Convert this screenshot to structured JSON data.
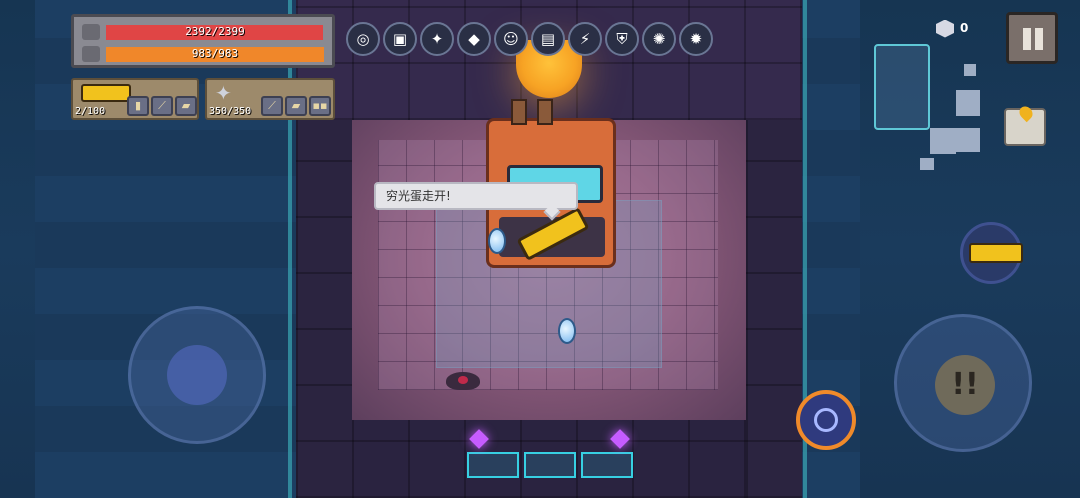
{
  "hud": {
    "hp": {
      "current": 2392,
      "max": 2399,
      "text": "2392/2399",
      "color": "#e04545"
    },
    "energy": {
      "current": 983,
      "max": 983,
      "text": "983/983",
      "color": "#f0872a"
    },
    "weapon_primary": {
      "ammo_text": "2/100",
      "icon": "golden-cannon-icon"
    },
    "weapon_secondary": {
      "ammo_text": "350/350",
      "icon": "shuriken-icon"
    },
    "gems": "0"
  },
  "buffs": [
    {
      "icon": "disk-buff-icon",
      "glyph": "◎"
    },
    {
      "icon": "mask-buff-icon",
      "glyph": "▣"
    },
    {
      "icon": "compass-buff-icon",
      "glyph": "✦"
    },
    {
      "icon": "crystal-buff-icon",
      "glyph": "◆"
    },
    {
      "icon": "face-buff-icon",
      "glyph": "☺"
    },
    {
      "icon": "book-buff-icon",
      "glyph": "▤"
    },
    {
      "icon": "lightning-buff-icon",
      "glyph": "⚡"
    },
    {
      "icon": "shield-buff-icon",
      "glyph": "⛨"
    },
    {
      "icon": "spark-buff-icon",
      "glyph": "✺"
    },
    {
      "icon": "fire-buff-icon",
      "glyph": "✹"
    }
  ],
  "dialogue": {
    "speech": "穷光蛋走开!"
  },
  "controls": {
    "attack_glyph": "!!",
    "skill_color": "#f08a2a"
  },
  "colors": {
    "accent_cyan": "#37d0e2",
    "gold": "#f1c21d",
    "crystal": "#c65cff"
  }
}
